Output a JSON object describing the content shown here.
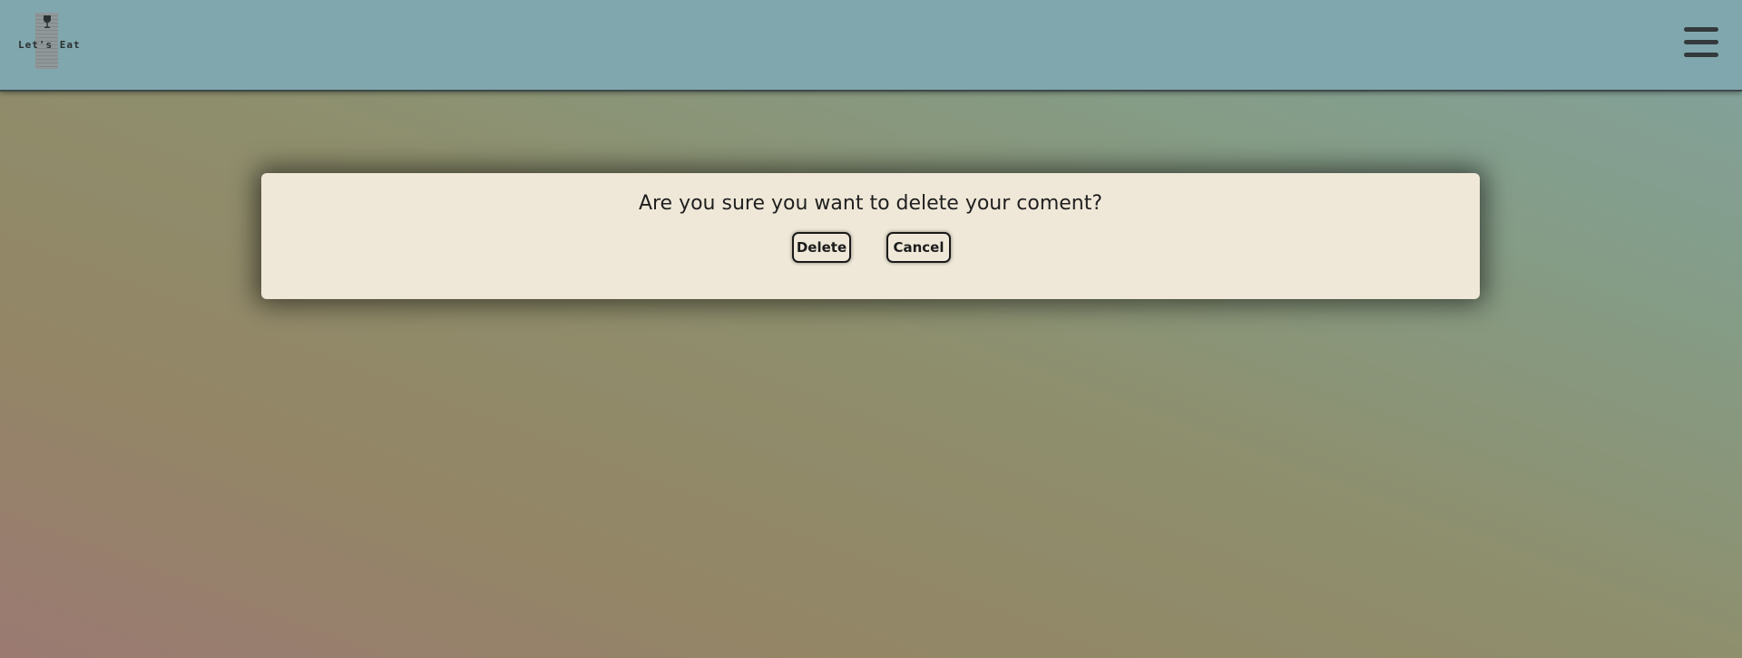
{
  "header": {
    "logo_text": "Let's Eat",
    "logo_icon": "wine-glass-icon",
    "menu_icon": "hamburger-menu-icon"
  },
  "dialog": {
    "message": "Are you sure you want to delete your coment?",
    "delete_label": "Delete",
    "cancel_label": "Cancel"
  },
  "colors": {
    "header_bg": "#81a7ae",
    "dialog_bg": "#efe8d8",
    "text": "#1f1f1f"
  }
}
